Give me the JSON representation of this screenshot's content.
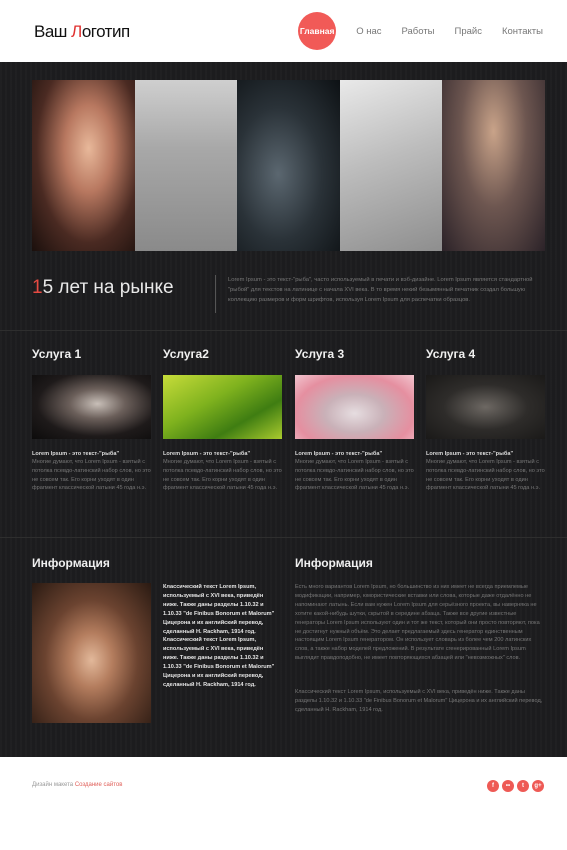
{
  "brand": {
    "logo_part1": "Ваш ",
    "logo_accent": "Л",
    "logo_part2": "оготип"
  },
  "nav": {
    "items": [
      "Главная",
      "О нас",
      "Работы",
      "Прайс",
      "Контакты"
    ]
  },
  "about": {
    "years_number": "1",
    "years_text": "5 лет на рынке",
    "text": "Lorem Ipsum - это текст-\"рыба\", часто используемый в печати и вэб-дизайне. Lorem Ipsum является стандартной \"рыбой\" для текстов на латинице с начала XVI века. В то время некий безымянный печатник создал большую коллекцию размеров и форм шрифтов, используя Lorem Ipsum для распечатки образцов."
  },
  "services": [
    {
      "title": "Услуга 1",
      "subtitle": "Lorem Ipsum - это текст-\"рыба\"",
      "body": "Многие думают, что Lorem Ipsum - взятый с потолка псевдо-латинский набор слов, но это не совсем так. Его корни уходят в один фрагмент классической латыни 45 года н.э."
    },
    {
      "title": "Услуга2",
      "subtitle": "Lorem Ipsum - это текст-\"рыба\"",
      "body": "Многие думают, что Lorem Ipsum - взятый с потолка псевдо-латинский набор слов, но это не совсем так. Его корни уходят в один фрагмент классической латыни 45 года н.э."
    },
    {
      "title": "Услуга 3",
      "subtitle": "Lorem Ipsum - это текст-\"рыба\"",
      "body": "Многие думают, что Lorem Ipsum - взятый с потолка псевдо-латинский набор слов, но это не совсем так. Его корни уходят в один фрагмент классической латыни 45 года н.э."
    },
    {
      "title": "Услуга 4",
      "subtitle": "Lorem Ipsum - это текст-\"рыба\"",
      "body": "Многие думают, что Lorem Ipsum - взятый с потолка псевдо-латинский набор слов, но это не совсем так. Его корни уходят в один фрагмент классической латыни 45 года н.э."
    }
  ],
  "info_left": {
    "title": "Информация",
    "text": "Классический текст Lorem Ipsum, используемый с XVI века, приведён ниже. Также даны разделы 1.10.32 и 1.10.33 \"de Finibus Bonorum et Malorum\" Цицерона и их английский перевод, сделанный H. Rackham, 1914 год. Классический текст Lorem Ipsum, используемый с XVI века, приведён ниже. Также даны разделы 1.10.32 и 1.10.33 \"de Finibus Bonorum et Malorum\" Цицерона и их английский перевод, сделанный H. Rackham, 1914 год."
  },
  "info_right": {
    "title": "Информация",
    "para1": "Есть много вариантов Lorem Ipsum, но большинство из них имеет не всегда приемлемые модификации, например, юмористические вставки или слова, которые даже отдалённо не напоминают латынь. Если вам нужен Lorem Ipsum для серьёзного проекта, вы наверняка не хотите какой-нибудь шутки, скрытой в середине абзаца. Также все другие известные генераторы Lorem Ipsum используют один и тот же текст, который они просто повторяют, пока не достигнут нужный объём. Это делает предлагаемый здесь генератор единственным настоящим Lorem Ipsum генератором. Он использует словарь из более чем 200 латинских слов, а также набор моделей предложений. В результате сгенерированный Lorem Ipsum выглядит правдоподобно, не имеет повторяющихся абзацей или \"невозможных\" слов.",
    "para2": "Классический текст Lorem Ipsum, используемый с XVI века, приведён ниже. Также даны разделы 1.10.32 и 1.10.33 \"de Finibus Bonorum et Malorum\" Цицерона и их английский перевод, сделанный H. Rackham, 1914 год."
  },
  "footer": {
    "credit_prefix": "Дизайн макета ",
    "credit_link": "Создание сайтов",
    "social": [
      {
        "icon": "facebook-icon",
        "glyph": "f"
      },
      {
        "icon": "flickr-icon",
        "glyph": "••"
      },
      {
        "icon": "twitter-icon",
        "glyph": "t"
      },
      {
        "icon": "google-plus-icon",
        "glyph": "g+"
      }
    ]
  },
  "colors": {
    "accent": "#f15a57",
    "dark_bg": "#1d1d1f",
    "years_accent": "#e64a42"
  }
}
